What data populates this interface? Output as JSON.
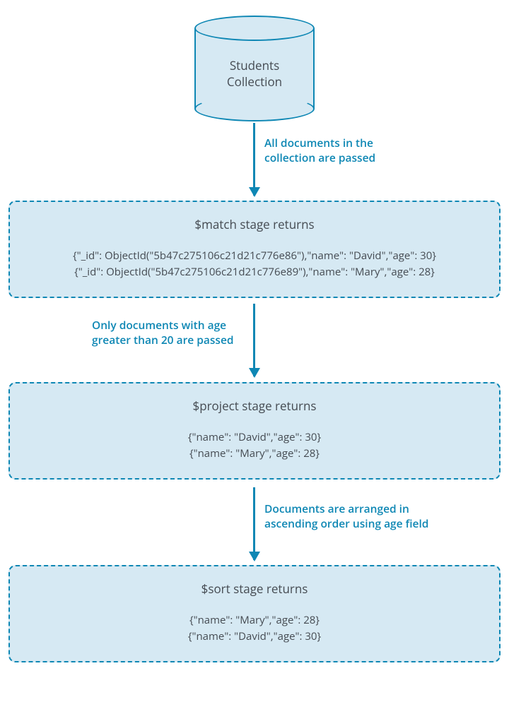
{
  "cylinder": {
    "line1": "Students",
    "line2": "Collection"
  },
  "arrows": {
    "a1": "All documents in the collection are passed",
    "a2": "Only documents with age greater than 20 are passed",
    "a3": "Documents are arranged in ascending order using age field"
  },
  "stages": {
    "match": {
      "title": "$match stage returns",
      "line1": "{\"_id\": ObjectId(\"5b47c275106c21d21c776e86\"),\"name\": \"David\",\"age\": 30}",
      "line2": "{\"_id\": ObjectId(\"5b47c275106c21d21c776e89\"),\"name\": \"Mary\",\"age\": 28}"
    },
    "project": {
      "title": "$project stage returns",
      "line1": "{\"name\": \"David\",\"age\": 30}",
      "line2": "{\"name\": \"Mary\",\"age\": 28}"
    },
    "sort": {
      "title": "$sort stage returns",
      "line1": "{\"name\": \"Mary\",\"age\": 28}",
      "line2": "{\"name\": \"David\",\"age\": 30}"
    }
  }
}
